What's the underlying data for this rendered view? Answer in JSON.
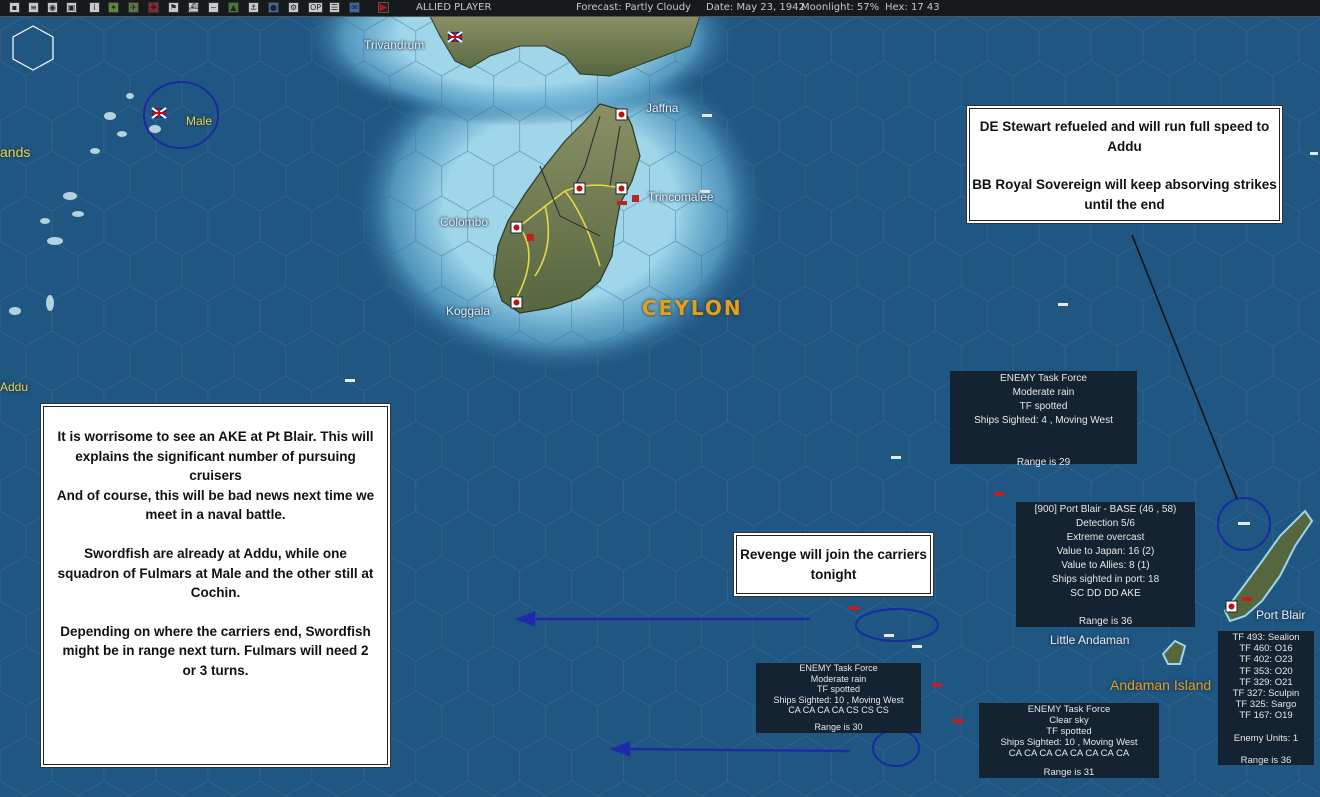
{
  "topbar": {
    "player": "ALLIED PLAYER",
    "forecast": "Forecast: Partly Cloudy",
    "date": "Date: May 23, 1942",
    "moonlight": "Moonlight: 57%",
    "hex": "Hex: 17  43",
    "icons": [
      "save-icon",
      "report-icon",
      "intel-icon",
      "ops-icon",
      "info-icon",
      "air-icon",
      "aircraft-icon",
      "naval-air-icon",
      "flag-icon",
      "ship-icon",
      "submarine-icon",
      "base-icon",
      "port-icon",
      "globe-icon",
      "gear-icon",
      "op-icon",
      "unit-list-icon",
      "mail-icon",
      "end-turn-icon"
    ],
    "op_label": "OP"
  },
  "places": {
    "trivandrum": "Trivandrum",
    "male": "Male",
    "islands_partial": "ands",
    "jaffna": "Jaffna",
    "trincomalee": "Trincomalee",
    "colombo": "Colombo",
    "koggala": "Koggala",
    "ceylon": "CEYLON",
    "addu_partial": "Addu",
    "little_andaman": "Little Andaman",
    "port_blair": "Port Blair",
    "andaman_islands": "Andaman Island"
  },
  "notes": {
    "top_right": [
      "DE Stewart refueled and will run full speed to Addu",
      "",
      "BB Royal Sovereign will keep absorving strikes until the end"
    ],
    "left": [
      "It is worrisome to see an AKE at Pt Blair. This will explains the significant number of pursuing cruisers",
      "And of course, this will be bad news next time we meet in a naval battle.",
      "",
      "Swordfish are already at Addu, while one squadron of Fulmars at Male and the other still at Cochin.",
      "",
      "Depending on where the carriers end, Swordfish might be in range next turn. Fulmars will need 2 or 3 turns."
    ],
    "revenge": [
      "Revenge will join the carriers tonight"
    ]
  },
  "panels": {
    "enemy_tf_1": [
      "ENEMY Task Force",
      "Moderate rain",
      "TF spotted",
      "Ships Sighted: 4 , Moving West",
      "",
      "",
      "Range is 29"
    ],
    "port_blair_base": [
      "[900] Port Blair  - BASE  (46 , 58)",
      "Detection 5/6",
      "Extreme overcast",
      "Value to Japan:  16 (2)",
      "Value to Allies:  8 (1)",
      "Ships sighted in port: 18",
      "SC DD DD AKE",
      "",
      "Range is 36"
    ],
    "enemy_tf_2": [
      "ENEMY Task Force",
      "Moderate rain",
      "TF spotted",
      "Ships Sighted: 10 , Moving West",
      "CA CA CA CA CS CS CS",
      "",
      "Range is 30"
    ],
    "enemy_tf_3": [
      "ENEMY Task Force",
      "Clear sky",
      "TF spotted",
      "Ships Sighted: 10 , Moving West",
      "CA CA CA CA CA CA CA CA",
      "",
      "Range is 31"
    ],
    "tf_list": [
      "TF 493: Sealion",
      "TF 460: O16",
      "TF 402: O23",
      "TF 353: O20",
      "TF 329: O21",
      "TF 327: Sculpin",
      "TF 325: Sargo",
      "TF 167: O19",
      "",
      "Enemy Units: 1",
      "",
      "Range is 36"
    ]
  },
  "colors": {
    "ocean": "#1f5682",
    "shallow": "#7fc4de",
    "land": "#6b7a52",
    "road": "#e6d84a",
    "circle": "#1a2aa0",
    "arrow": "#1f2aa8"
  }
}
